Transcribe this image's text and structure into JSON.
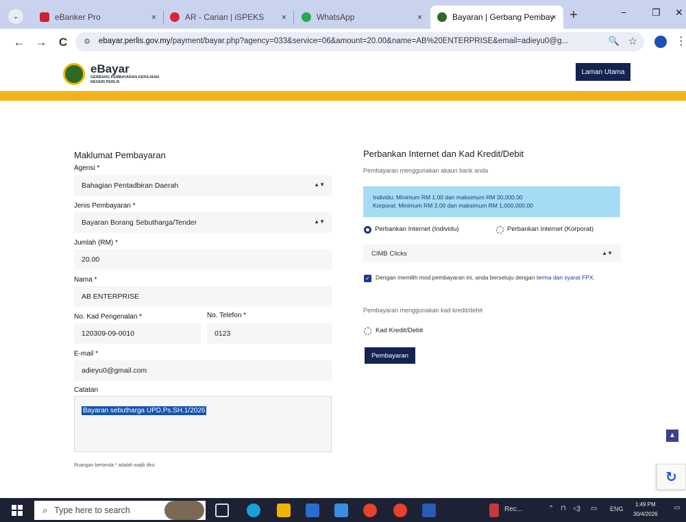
{
  "browser": {
    "tabs": [
      {
        "title": "eBanker Pro",
        "fav_color": "#d02030"
      },
      {
        "title": "AR - Carian | iSPEKS",
        "fav_color": "#d8243a"
      },
      {
        "title": "WhatsApp",
        "fav_color": "#1fae4f"
      },
      {
        "title": "Bayaran | Gerbang Pembay",
        "fav_color": "#2d6b22",
        "active": true
      }
    ],
    "url_host": "ebayar.perlis.gov.my",
    "url_path": "/payment/bayar.php?agency=033&service=06&amount=20.00&name=AB%20ENTERPRISE&email=adieyu0@g...",
    "tab_close": "×",
    "new_tab": "+",
    "minimize": "−",
    "maximize": "❐",
    "close": "✕"
  },
  "site": {
    "logo_title": "eBayar",
    "logo_sub": "GERBANG PEMBAYARAN KERAJAAN NEGERI PERLIS",
    "home_button": "Laman Utama",
    "accent_color": "#f2b31a",
    "primary_color": "#14234f"
  },
  "form": {
    "title": "Maklumat Pembayaran",
    "agency_label": "Agensi *",
    "agency_value": "Bahagian Pentadbiran Daerah",
    "payment_type_label": "Jenis Pembayaran *",
    "payment_type_value": "Bayaran Borang Sebutharga/Tender",
    "amount_label": "Jumlah (RM) *",
    "amount_value": "20.00",
    "name_label": "Nama *",
    "name_value": "AB ENTERPRISE",
    "ic_label": "No. Kad Pengenalan *",
    "ic_value": "120309-09-0010",
    "phone_label": "No. Telefon *",
    "phone_value": "0123",
    "email_label": "E-mail *",
    "email_value": "adieyu0@gmail.com",
    "notes_label": "Catatan",
    "notes_value": "Bayaran sebutharga UPD.Ps.SH.1/2026",
    "footnote": "Ruangan bertanda * adalah wajib diisi"
  },
  "payment": {
    "title": "Perbankan Internet dan Kad Kredit/Debit",
    "subtitle": "Pembayaran menggunakan akaun bank anda",
    "limit_individual": "Individu: Minimum RM 1.00 dan maksimum RM 30,000.00",
    "limit_corporate": "Korporat: Minimum RM 2.00 dan maksimum RM 1,000,000.00",
    "option_individual": "Perbankan Internet (Individu)",
    "option_corporate": "Perbankan Internet (Korporat)",
    "bank_value": "CIMB Clicks",
    "terms_text": "Dengan memilih mod pembayaran ini, anda bersetuju dengan",
    "terms_link": "terma dan syarat FPX.",
    "card_subtitle": "Pembayaran menggunakan kad kredit/debit",
    "card_option": "Kad Kredit/Debit",
    "pay_button": "Pembayaran"
  },
  "taskbar": {
    "search_placeholder": "Type here to search",
    "recording_label": "Rec...",
    "language": "ENG",
    "time": "1:49 PM",
    "date": "30/4/2026"
  }
}
